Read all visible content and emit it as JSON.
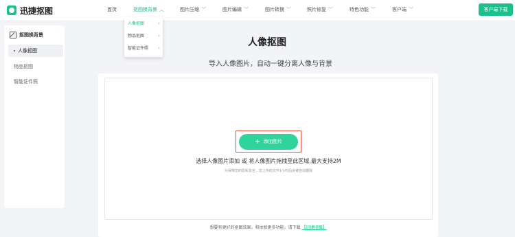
{
  "brand": {
    "name": "迅捷抠图",
    "accent": "#19c28c"
  },
  "nav": {
    "items": [
      {
        "label": "首页"
      },
      {
        "label": "抠图换背景"
      },
      {
        "label": "图片压缩"
      },
      {
        "label": "图片编辑"
      },
      {
        "label": "图片转换"
      },
      {
        "label": "照片修复"
      },
      {
        "label": "特色功能"
      },
      {
        "label": "客户端"
      }
    ],
    "download_label": "客户端下载"
  },
  "dropdown": {
    "items": [
      {
        "label": "人像抠图"
      },
      {
        "label": "物品抠图"
      },
      {
        "label": "智能证件照"
      }
    ]
  },
  "sidebar": {
    "header": "抠图换背景",
    "items": [
      {
        "label": "人像抠图"
      },
      {
        "label": "物品抠图"
      },
      {
        "label": "智能证件照"
      }
    ]
  },
  "main": {
    "title": "人像抠图",
    "subtitle": "导入人像图片，自动一键分离人像与背景",
    "add_label": "添加图片",
    "hint": "选择人像图片添加 或 将人像图片拖拽至此区域,最大支持2M",
    "note": "为保障您的隐私安全，您上传的文件1小时后会被自动删除",
    "footer_text": "想要有更好的抠图效果，和体验更多功能，请下载",
    "footer_link": "【迅捷抠图】"
  }
}
